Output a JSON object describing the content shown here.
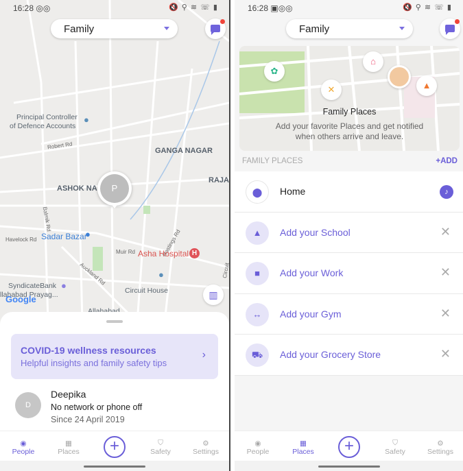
{
  "left": {
    "status": {
      "time": "16:28",
      "icons": "🔇 ⚲ ≋ ☏ ▮"
    },
    "circle_selector": {
      "value": "Family"
    },
    "map": {
      "member_initial": "P",
      "labels": [
        "Principal Controller",
        "of Defence Accounts",
        "Robert Rd",
        "GANGA NAGAR",
        "ASHOK NAG",
        "RAJAI",
        "Balmik Rd",
        "Havelock Rd",
        "Sadar Bazar",
        "Muir Rd",
        "Hastings Rd",
        "Asha Hospital",
        "Auckland Rd",
        "SyndicateBank",
        "llahabad Prayag...",
        "Circuit House",
        "Allahabad",
        "Circuit"
      ],
      "attribution": "Google"
    },
    "covid": {
      "title": "COVID-19 wellness resources",
      "subtitle": "Helpful insights and family safety tips"
    },
    "person": {
      "initial": "D",
      "name": "Deepika",
      "status": "No network or phone off",
      "since": "Since 24 April 2019"
    }
  },
  "right": {
    "status": {
      "time": "16:28",
      "icons": "🔇 ⚲ ≋ ☏ ▮"
    },
    "circle_selector": {
      "value": "Family"
    },
    "hero": {
      "title": "Family Places",
      "subtitle": "Add your favorite Places and get notified when others arrive and leave."
    },
    "section": {
      "title": "FAMILY PLACES",
      "add": "+ADD"
    },
    "places": [
      {
        "label": "Home",
        "icon": "pin-icon"
      },
      {
        "label": "Add your School",
        "icon": "graduation-cap-icon"
      },
      {
        "label": "Add your Work",
        "icon": "briefcase-icon"
      },
      {
        "label": "Add your Gym",
        "icon": "dumbbell-icon"
      },
      {
        "label": "Add your Grocery Store",
        "icon": "cart-icon"
      }
    ]
  },
  "nav": {
    "people": "People",
    "places": "Places",
    "safety": "Safety",
    "settings": "Settings"
  },
  "colors": {
    "accent": "#6a5ed8",
    "notification": "#f0443a",
    "hospital": "#e0545a"
  }
}
